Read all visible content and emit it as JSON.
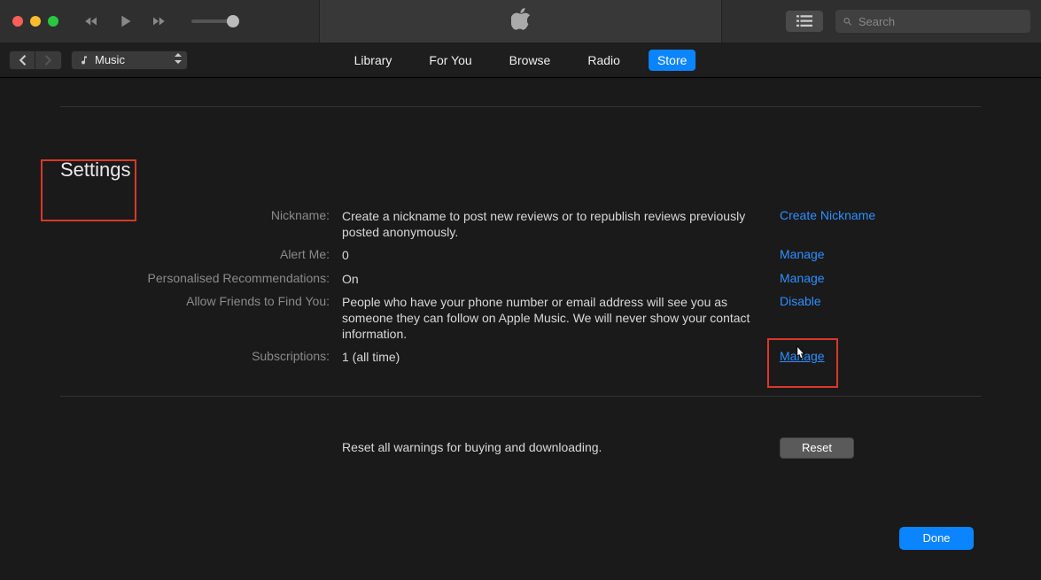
{
  "header": {
    "search_placeholder": "Search",
    "source": "Music"
  },
  "tabs": [
    {
      "label": "Library",
      "active": false
    },
    {
      "label": "For You",
      "active": false
    },
    {
      "label": "Browse",
      "active": false
    },
    {
      "label": "Radio",
      "active": false
    },
    {
      "label": "Store",
      "active": true
    }
  ],
  "page_title": "Settings",
  "rows": {
    "nickname": {
      "label": "Nickname:",
      "value": "Create a nickname to post new reviews or to republish reviews previously posted anonymously.",
      "action": "Create Nickname"
    },
    "alert": {
      "label": "Alert Me:",
      "value": "0",
      "action": "Manage"
    },
    "rec": {
      "label": "Personalised Recommendations:",
      "value": "On",
      "action": "Manage"
    },
    "friends": {
      "label": "Allow Friends to Find You:",
      "value": "People who have your phone number or email address will see you as someone they can follow on Apple Music. We will never show your contact information.",
      "action": "Disable"
    },
    "subs": {
      "label": "Subscriptions:",
      "value": "1 (all time)",
      "action": "Manage"
    }
  },
  "reset": {
    "text": "Reset all warnings for buying and downloading.",
    "button": "Reset"
  },
  "done": "Done"
}
